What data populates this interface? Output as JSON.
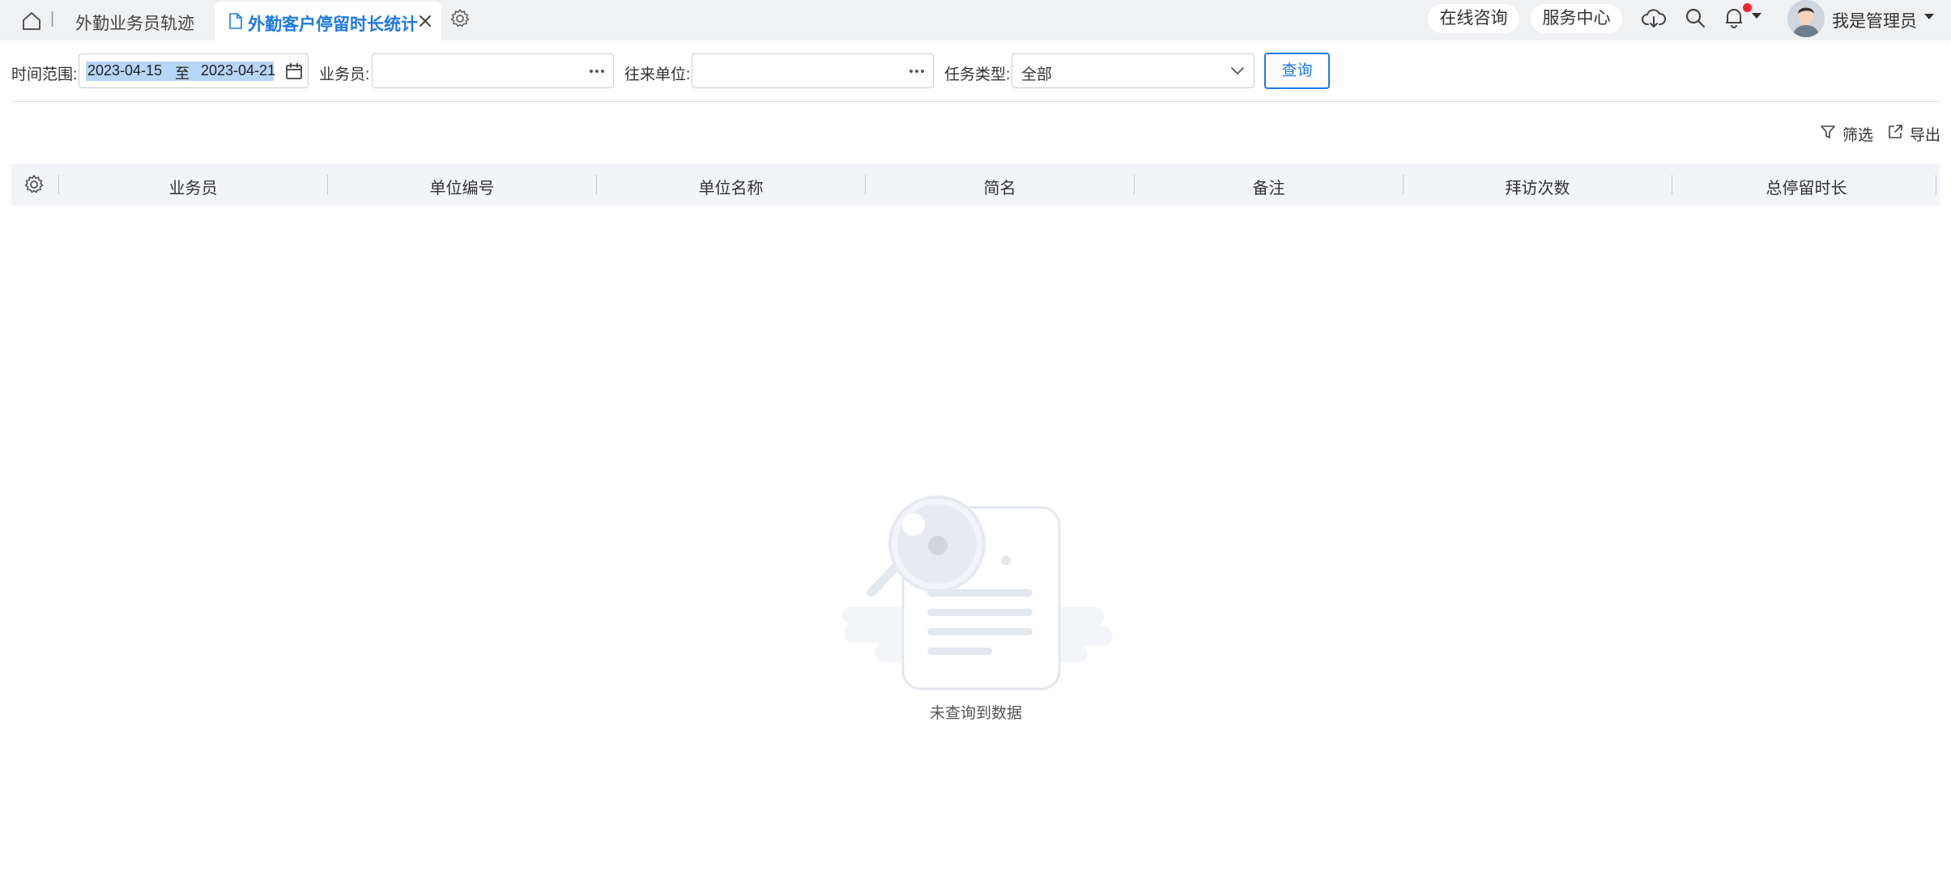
{
  "tabs": {
    "home_separator": "|",
    "inactive_tab_label": "外勤业务员轨迹",
    "active_tab_label": "外勤客户停留时长统计"
  },
  "header": {
    "consult_label": "在线咨询",
    "service_label": "服务中心",
    "user_name": "我是管理员",
    "notification_badge_color": "#f5222d"
  },
  "filters": {
    "time_range_label": "时间范围:",
    "date_start": "2023-04-15",
    "date_separator": "至",
    "date_end": "2023-04-21",
    "salesman_label": "业务员:",
    "salesman_value": "",
    "partner_unit_label": "往来单位:",
    "partner_unit_value": "",
    "task_type_label": "任务类型:",
    "task_type_value": "全部",
    "query_button": "查询"
  },
  "toolbar": {
    "filter_label": "筛选",
    "export_label": "导出"
  },
  "table": {
    "columns": [
      "业务员",
      "单位编号",
      "单位名称",
      "简名",
      "备注",
      "拜访次数",
      "总停留时长"
    ],
    "rows": []
  },
  "empty_state": {
    "message": "未查询到数据"
  },
  "colors": {
    "accent": "#1f7ae0",
    "topbar_bg": "#f0f1f3",
    "table_header_bg": "#f2f4f8",
    "date_selection_bg": "#b7d5f7"
  }
}
